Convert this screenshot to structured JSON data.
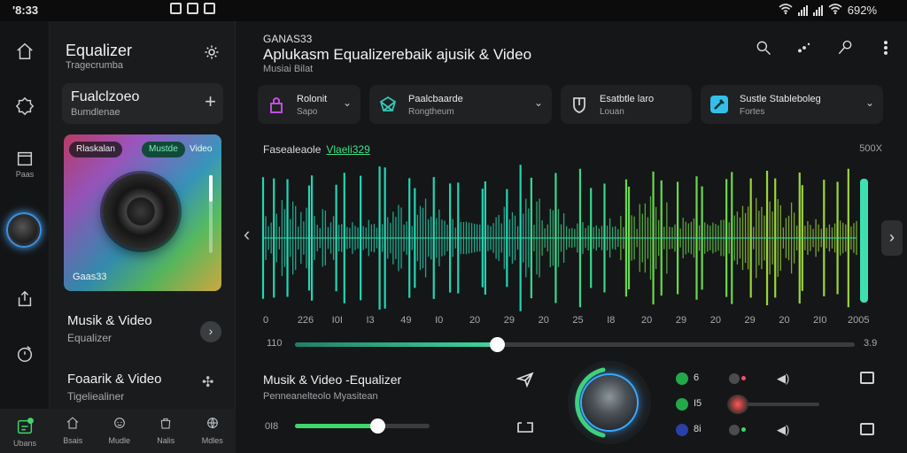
{
  "status": {
    "time": "'8:33",
    "battery": "692%"
  },
  "rail": {
    "item_label": "Paas",
    "bottom_label": "Ubans"
  },
  "panel": {
    "title": "Equalizer",
    "subtitle": "Tragecrumba",
    "card": {
      "title": "Fualclzoeo",
      "subtitle": "Bumdlenae"
    },
    "art": {
      "chip_a": "Rlaskalan",
      "chip_b": "Mustde",
      "chip_c": "Video",
      "caption": "Gaas33"
    },
    "item1": {
      "title": "Musik & Video",
      "subtitle": "Equalizer"
    },
    "item2": {
      "title": "Foaarik & Video",
      "subtitle": "Tigeliealiner"
    },
    "tabs": [
      "Bsais",
      "Mudle",
      "Nalis",
      "Mdles"
    ]
  },
  "main": {
    "app_name": "GANAS33",
    "title": "Aplukasm Equalizerebaik ajusik & Video",
    "subtitle": "Musiai Bilat",
    "presets": [
      {
        "title": "Rolonit",
        "subtitle": "Sapo",
        "color": "#c04de0"
      },
      {
        "title": "Paalcbaarde",
        "subtitle": "Rongtheum",
        "color": "#35c9b5"
      },
      {
        "title": "Esatbtle laro",
        "subtitle": "Louan",
        "color": "#d0d0d0"
      },
      {
        "title": "Sustle Stableboleg",
        "subtitle": "Fortes",
        "color": "#33c0e8"
      }
    ],
    "viz_label": "Fasealeaole",
    "viz_highlight": "Vlaeli329",
    "viz_max": "500X",
    "ticks": [
      "0",
      "226",
      "I0I",
      "I3",
      "49",
      "I0",
      "20",
      "29",
      "20",
      "25",
      "I8",
      "20",
      "29",
      "20",
      "29",
      "20",
      "2I0",
      "2005"
    ],
    "seek": {
      "left": "110",
      "right": "3.9",
      "progress": 0.36
    },
    "now_playing": {
      "title": "Musik & Video -Equalizer",
      "subtitle": "Penneanelteolo Myasitean"
    },
    "volume": {
      "label": "0I8",
      "level": 0.61
    },
    "channels": [
      {
        "value": "6",
        "color": "#22a94a",
        "toggle_color": "#ff4a6a"
      },
      {
        "value": "I5",
        "color": "#22a94a",
        "toggle_color": "#ff5a5a"
      },
      {
        "value": "8i",
        "color": "#2a3fa8",
        "toggle_color": "#3fd76a"
      }
    ]
  }
}
